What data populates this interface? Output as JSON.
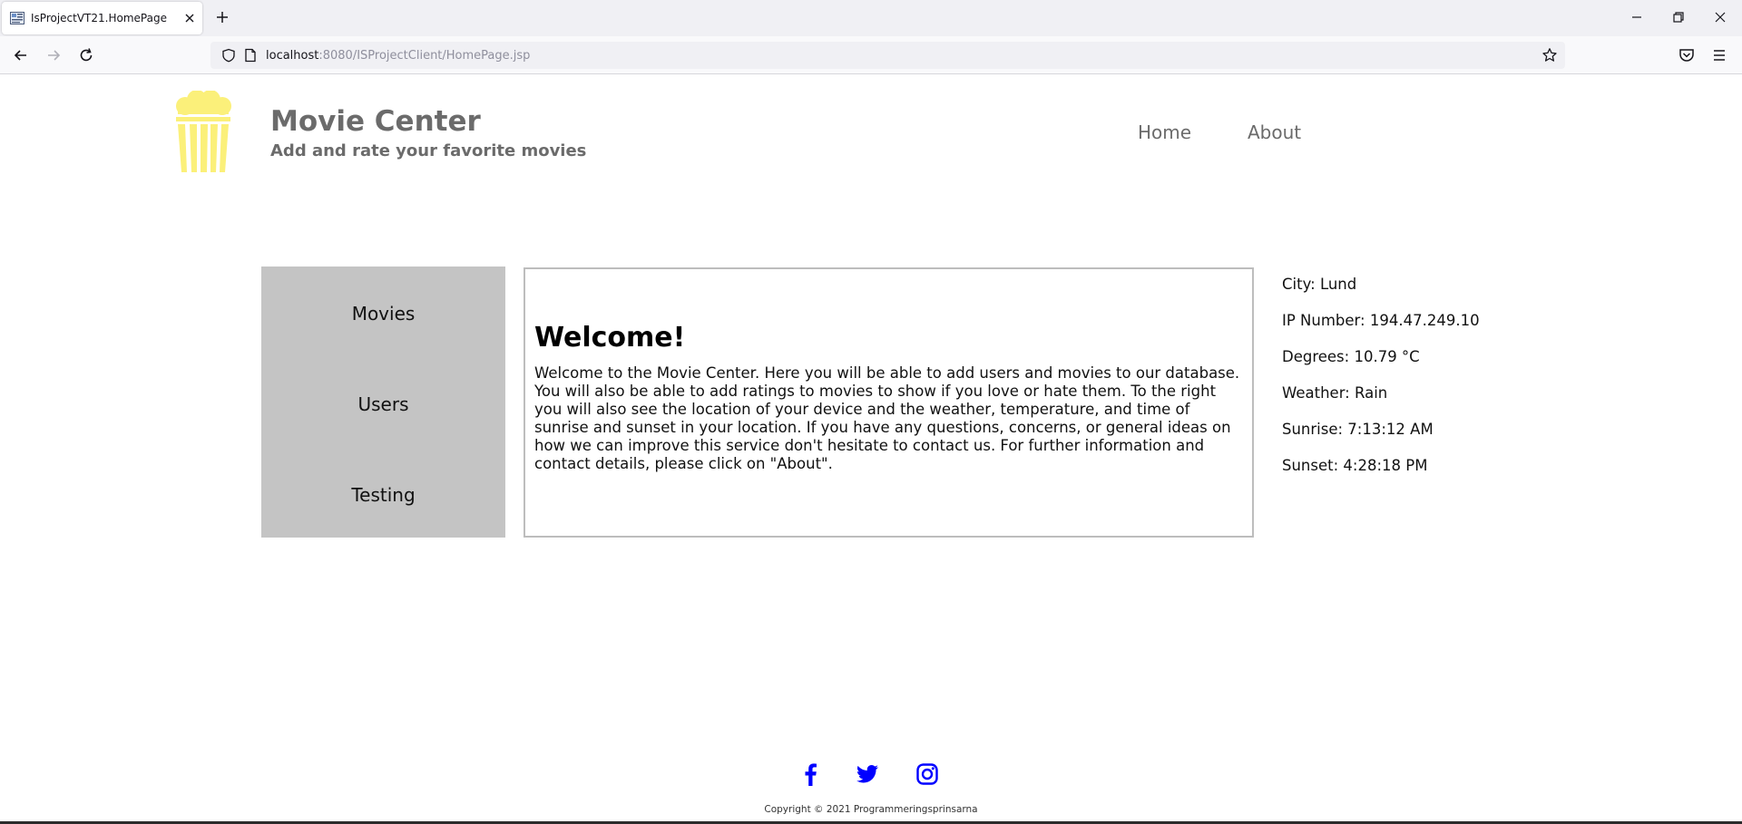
{
  "browser": {
    "tab_title": "IsProjectVT21.HomePage",
    "url_host": "localhost",
    "url_rest": ":8080/ISProjectClient/HomePage.jsp"
  },
  "header": {
    "title": "Movie Center",
    "subtitle": "Add and rate your favorite movies",
    "nav": [
      {
        "label": "Home"
      },
      {
        "label": "About"
      }
    ]
  },
  "sidebar": {
    "items": [
      {
        "label": "Movies"
      },
      {
        "label": "Users"
      },
      {
        "label": "Testing"
      }
    ]
  },
  "main": {
    "heading": "Welcome!",
    "body": "Welcome to the Movie Center. Here you will be able to add users and movies to our database. You will also be able to add ratings to movies to show if you love or hate them. To the right you will also see the location of your device and the weather, temperature, and time of sunrise and sunset in your location. If you have any questions, concerns, or general ideas on how we can improve this service don't hesitate to contact us. For further information and contact details, please click on \"About\"."
  },
  "info": {
    "city": "City: Lund",
    "ip": "IP Number: 194.47.249.10",
    "degrees": "Degrees: 10.79 °C",
    "weather": "Weather: Rain",
    "sunrise": "Sunrise: 7:13:12 AM",
    "sunset": "Sunset: 4:28:18 PM"
  },
  "footer": {
    "copyright": "Copyright © 2021 Programmeringsprinsarna",
    "social": [
      "facebook-icon",
      "twitter-icon",
      "instagram-icon"
    ]
  },
  "colors": {
    "logo": "#fbf07a",
    "header_text": "#6b6b6b",
    "sidebar_bg": "#c4c4c4",
    "social_icons": "#0000ff"
  }
}
